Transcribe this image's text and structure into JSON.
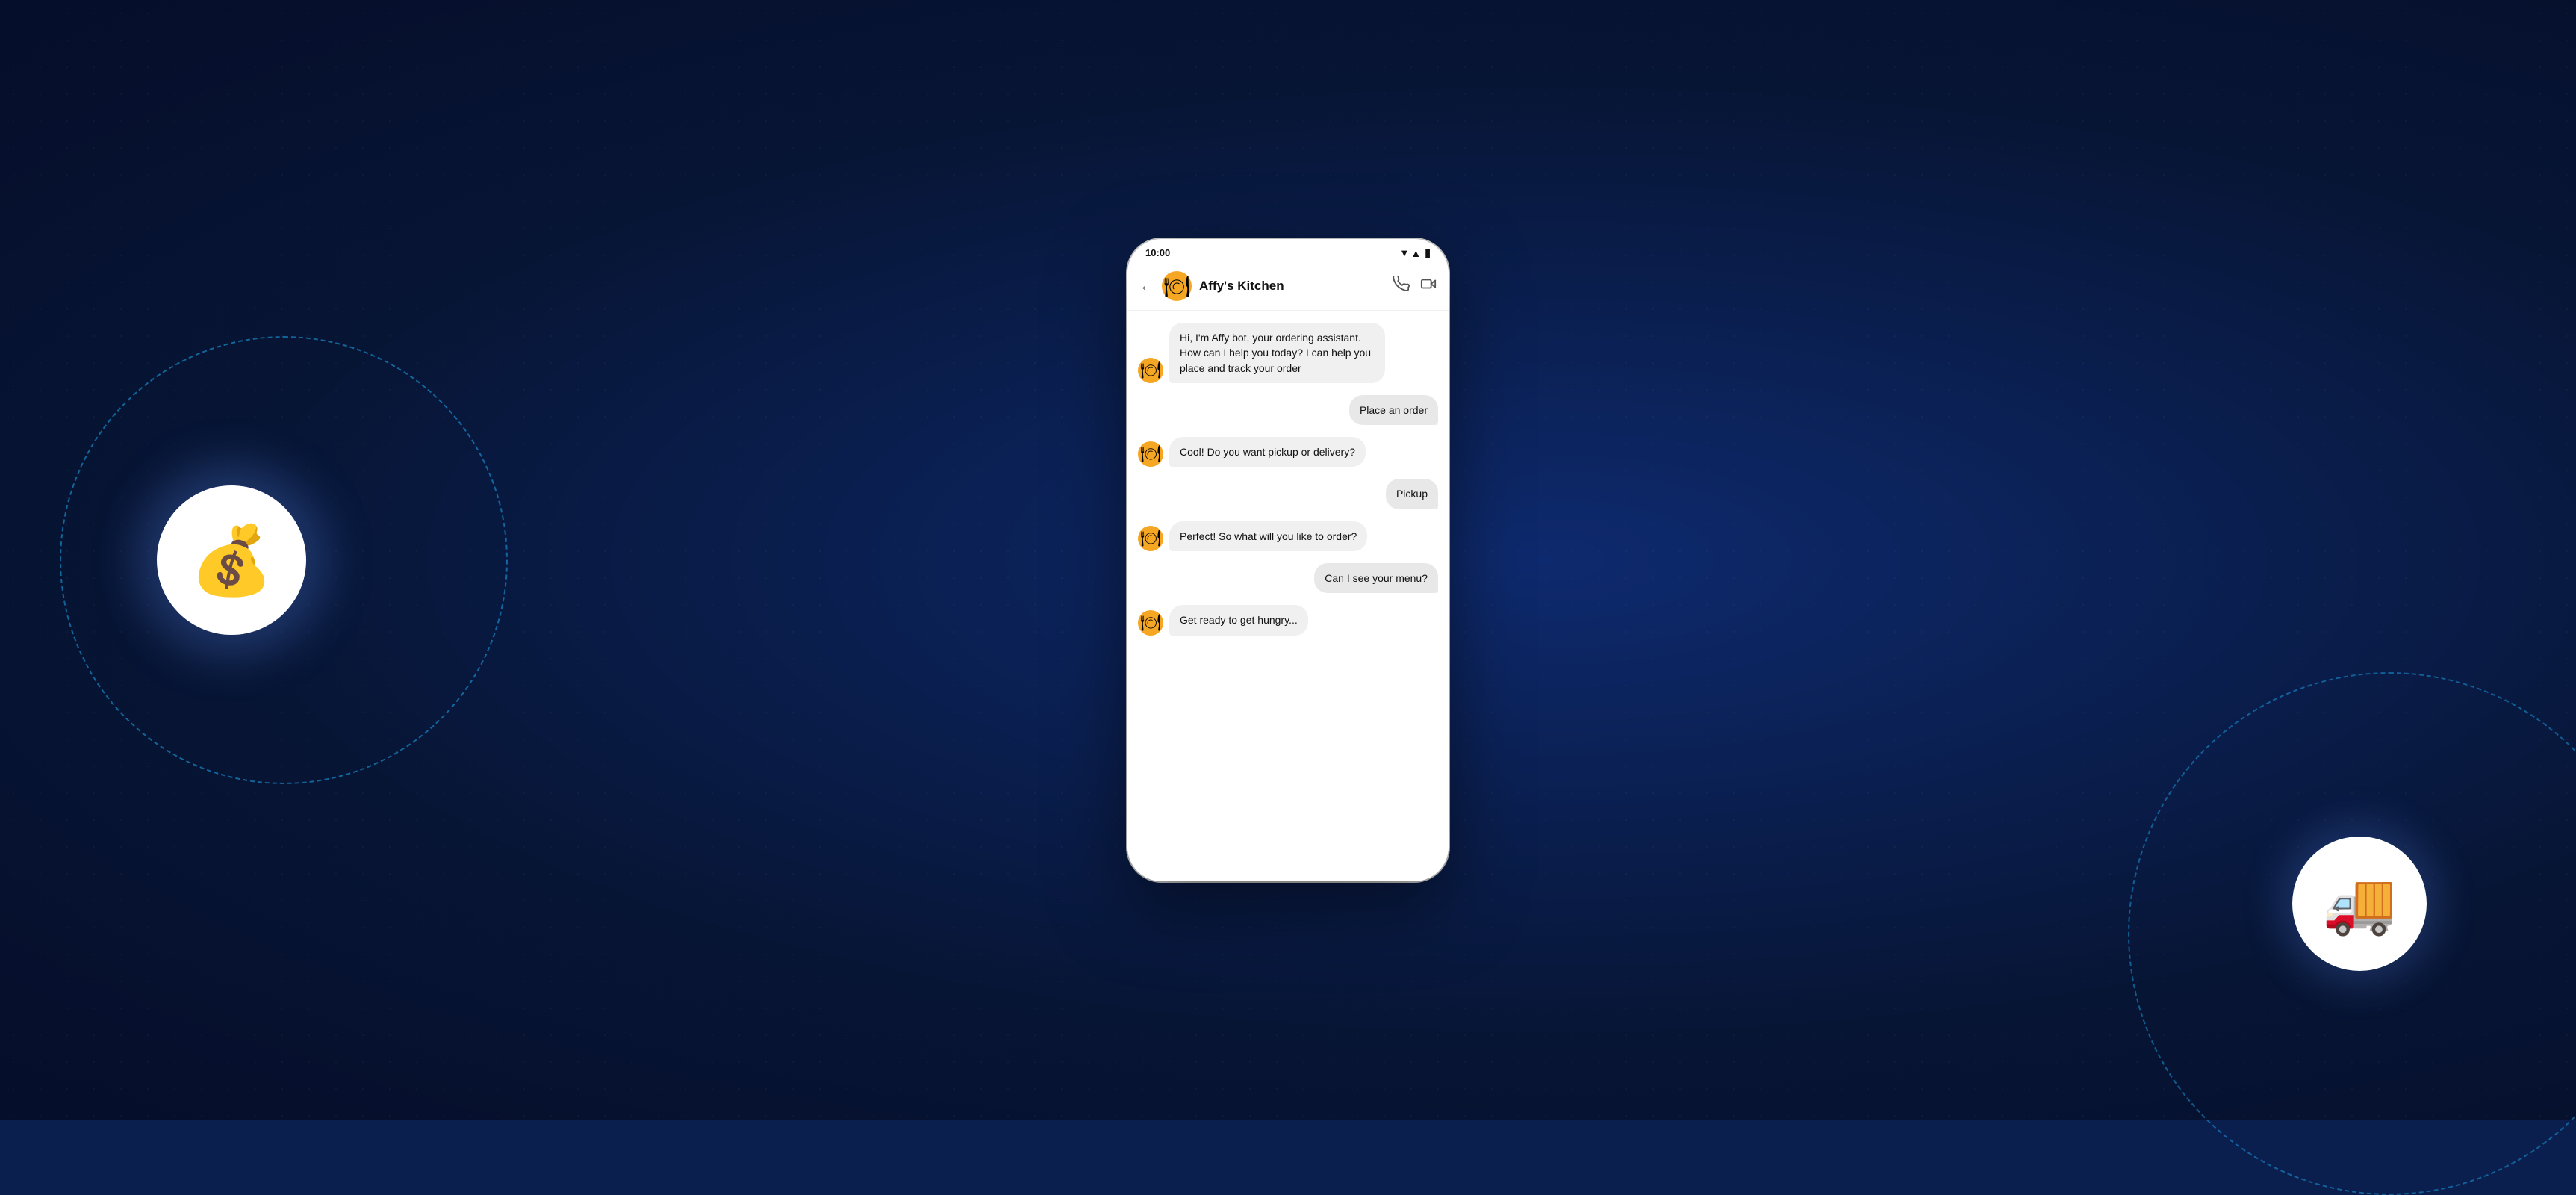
{
  "background": {
    "color": "#0a1f4e"
  },
  "left_decoration": {
    "emoji": "💰",
    "aria_label": "money-bag"
  },
  "right_decoration": {
    "emoji": "🚚",
    "aria_label": "delivery-truck"
  },
  "status_bar": {
    "time": "10:00",
    "wifi_symbol": "▼",
    "signal_symbol": "▲",
    "battery_symbol": "▮"
  },
  "header": {
    "back_label": "←",
    "avatar_emoji": "🍽",
    "title": "Affy's Kitchen",
    "phone_icon": "📞",
    "video_icon": "⬜"
  },
  "messages": [
    {
      "id": "msg-1",
      "type": "bot",
      "text": "Hi, I'm Affy bot, your ordering assistant. How can I help you today? I can help you place and track your order"
    },
    {
      "id": "msg-2",
      "type": "user",
      "text": "Place an order"
    },
    {
      "id": "msg-3",
      "type": "bot",
      "text": "Cool! Do you want pickup or delivery?"
    },
    {
      "id": "msg-4",
      "type": "user",
      "text": "Pickup"
    },
    {
      "id": "msg-5",
      "type": "bot",
      "text": "Perfect! So what will you like to order?"
    },
    {
      "id": "msg-6",
      "type": "user",
      "text": "Can I see your menu?"
    },
    {
      "id": "msg-7",
      "type": "bot",
      "text": "Get ready to get hungry..."
    }
  ]
}
